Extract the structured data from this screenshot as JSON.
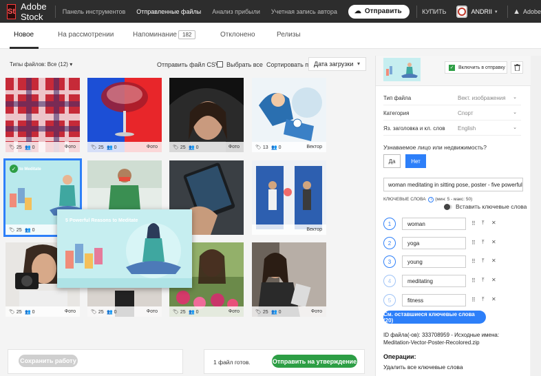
{
  "app": {
    "logo": "St",
    "title": "Adobe Stock"
  },
  "topnav": {
    "links": [
      "Панель инструментов",
      "Отправленные файлы",
      "Анализ прибыли",
      "Учетная запись автора"
    ],
    "active_index": 1,
    "submit_label": "Отправить",
    "buy_label": "КУПИТЬ",
    "user_name": "ANDRII",
    "adobe_label": "Adobe"
  },
  "tabs": {
    "items": [
      "Новое",
      "На рассмотрении",
      "Напоминание",
      "Отклонено",
      "Релизы"
    ],
    "active_index": 0,
    "reminder_count": "182"
  },
  "toolbar": {
    "file_types": "Типы файлов: Все (12)",
    "csv": "Отправить файл CSV",
    "select_all": "Выбрать все",
    "sort_label": "Сортировать по",
    "sort_value": "Дата загрузки"
  },
  "grid": {
    "cards": [
      {
        "likes": "25",
        "users": "0",
        "type": "Фото"
      },
      {
        "likes": "25",
        "users": "0",
        "type": "Фото"
      },
      {
        "likes": "25",
        "users": "0",
        "type": "Фото"
      },
      {
        "likes": "13",
        "users": "0",
        "type": "Вектор"
      },
      {
        "likes": "25",
        "users": "0",
        "type": ""
      },
      {
        "likes": "",
        "users": "",
        "type": ""
      },
      {
        "likes": "",
        "users": "",
        "type": ""
      },
      {
        "likes": "",
        "users": "",
        "type": "Вектор"
      },
      {
        "likes": "25",
        "users": "0",
        "type": "Фото"
      },
      {
        "likes": "25",
        "users": "0",
        "type": "Фото"
      },
      {
        "likes": "25",
        "users": "0",
        "type": "Фото"
      },
      {
        "likes": "25",
        "users": "0",
        "type": "Фото"
      }
    ],
    "selected_card_text": "to Meditate",
    "preview_title": "5 Powerful Reasons to Meditate"
  },
  "bottom": {
    "save_label": "Сохранить работу",
    "ready_text": "1 файл готов.",
    "approve_label": "Отправить на утверждение"
  },
  "panel": {
    "include_label": "Включить в отправку",
    "fields": [
      {
        "label": "Тип файла",
        "value": "Вект. изображения"
      },
      {
        "label": "Категория",
        "value": "Спорт"
      },
      {
        "label": "Яз. заголовка и кл. слов",
        "value": "English"
      }
    ],
    "question": "Узнаваемое лицо или недвижимость?",
    "yes": "Да",
    "no": "Нет",
    "title_value": "woman meditating in sitting pose, poster - five powerful",
    "keywords_label": "КЛЮЧЕВЫЕ СЛОВА",
    "keywords_hint": "(мин: 5 - макс: 50)",
    "insert_keywords": "Вставить ключевые слова",
    "keywords": [
      {
        "n": "1",
        "word": "woman"
      },
      {
        "n": "2",
        "word": "yoga"
      },
      {
        "n": "3",
        "word": "young"
      },
      {
        "n": "4",
        "word": "meditating"
      },
      {
        "n": "5",
        "word": "fitness"
      }
    ],
    "more_keywords": "См. оставшиеся ключевые слова (20)",
    "file_id": "ID файла(-ов): 333708959 - Исходные имена: Meditation-Vector-Poster-Recolored.zip",
    "operations": "Операции:",
    "delete_keywords": "Удалить все ключевые слова"
  },
  "colors": {
    "accent_blue": "#2d7ff9",
    "accent_green": "#2d9e45",
    "topbar": "#2d2d2d"
  }
}
